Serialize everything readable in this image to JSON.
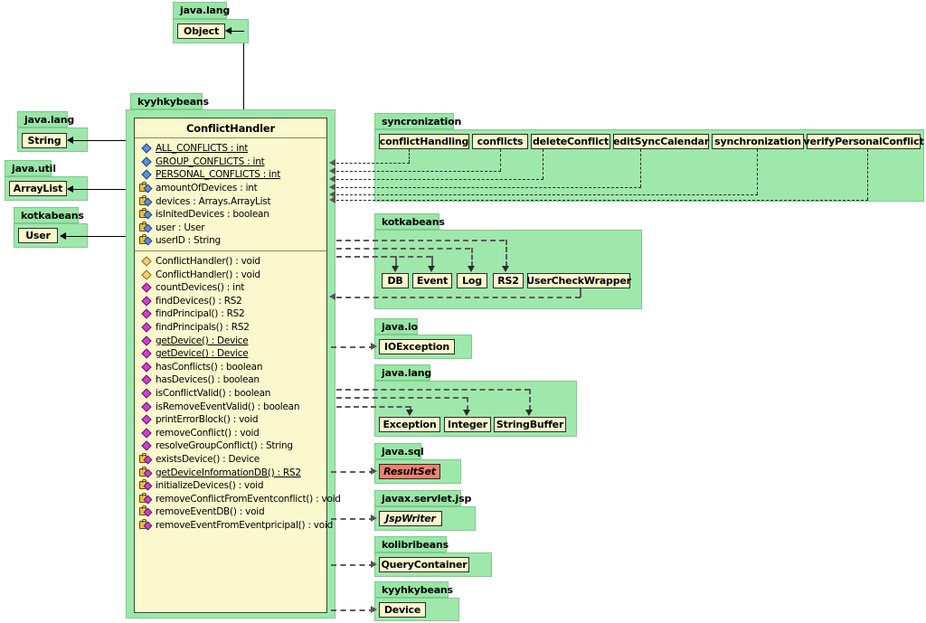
{
  "diagram": {
    "type": "uml-class-diagram",
    "main_class": {
      "package": "kyyhkybeans",
      "name": "ConflictHandler",
      "attributes": [
        {
          "icon": "public-attribute",
          "label": "ALL_CONFLICTS : int",
          "static": true,
          "visibility": "public"
        },
        {
          "icon": "public-attribute",
          "label": "GROUP_CONFLICTS : int",
          "static": true,
          "visibility": "public"
        },
        {
          "icon": "public-attribute",
          "label": "PERSONAL_CONFLICTS : int",
          "static": true,
          "visibility": "public"
        },
        {
          "icon": "private-attribute",
          "label": "amountOfDevices : int",
          "static": false,
          "visibility": "private"
        },
        {
          "icon": "private-attribute",
          "label": "devices : Arrays.ArrayList",
          "static": false,
          "visibility": "private"
        },
        {
          "icon": "private-attribute",
          "label": "isInitedDevices : boolean",
          "static": false,
          "visibility": "private"
        },
        {
          "icon": "private-attribute",
          "label": "user : User",
          "static": false,
          "visibility": "private"
        },
        {
          "icon": "private-attribute",
          "label": "userID : String",
          "static": false,
          "visibility": "private"
        }
      ],
      "methods": [
        {
          "icon": "constructor",
          "label": "ConflictHandler() : void",
          "static": false,
          "visibility": "public"
        },
        {
          "icon": "constructor",
          "label": "ConflictHandler() : void",
          "static": false,
          "visibility": "public"
        },
        {
          "icon": "public-method",
          "label": "countDevices() : int",
          "static": false,
          "visibility": "public"
        },
        {
          "icon": "public-method",
          "label": "findDevices() : RS2",
          "static": false,
          "visibility": "public"
        },
        {
          "icon": "public-method",
          "label": "findPrincipal() : RS2",
          "static": false,
          "visibility": "public"
        },
        {
          "icon": "public-method",
          "label": "findPrincipals() : RS2",
          "static": false,
          "visibility": "public"
        },
        {
          "icon": "public-method",
          "label": "getDevice() : Device",
          "static": true,
          "visibility": "public"
        },
        {
          "icon": "public-method",
          "label": "getDevice() : Device",
          "static": true,
          "visibility": "public"
        },
        {
          "icon": "public-method",
          "label": "hasConflicts() : boolean",
          "static": false,
          "visibility": "public"
        },
        {
          "icon": "public-method",
          "label": "hasDevices() : boolean",
          "static": false,
          "visibility": "public"
        },
        {
          "icon": "public-method",
          "label": "isConflictValid() : boolean",
          "static": false,
          "visibility": "public"
        },
        {
          "icon": "public-method",
          "label": "isRemoveEventValid() : boolean",
          "static": false,
          "visibility": "public"
        },
        {
          "icon": "public-method",
          "label": "printErrorBlock() : void",
          "static": false,
          "visibility": "public"
        },
        {
          "icon": "public-method",
          "label": "removeConflict() : void",
          "static": false,
          "visibility": "public"
        },
        {
          "icon": "public-method",
          "label": "resolveGroupConflict() : String",
          "static": false,
          "visibility": "public"
        },
        {
          "icon": "private-method",
          "label": "existsDevice() : Device",
          "static": false,
          "visibility": "private"
        },
        {
          "icon": "private-method",
          "label": "getDeviceInformationDB() : RS2",
          "static": true,
          "visibility": "private"
        },
        {
          "icon": "private-method",
          "label": "initializeDevices() : void",
          "static": false,
          "visibility": "private"
        },
        {
          "icon": "private-method",
          "label": "removeConflictFromEventconflict() : void",
          "static": false,
          "visibility": "private"
        },
        {
          "icon": "private-method",
          "label": "removeEventDB() : void",
          "static": false,
          "visibility": "private"
        },
        {
          "icon": "private-method",
          "label": "removeEventFromEventpricipal() : void",
          "static": false,
          "visibility": "private"
        }
      ]
    },
    "packages": [
      {
        "id": "pkg-java-lang-object",
        "name": "java.lang",
        "classes": [
          {
            "name": "Object",
            "kind": "class"
          }
        ]
      },
      {
        "id": "pkg-java-lang-string",
        "name": "java.lang",
        "classes": [
          {
            "name": "String",
            "kind": "class"
          }
        ]
      },
      {
        "id": "pkg-java-util",
        "name": "java.util",
        "classes": [
          {
            "name": "ArrayList",
            "kind": "class"
          }
        ]
      },
      {
        "id": "pkg-kotkabeans-user",
        "name": "kotkabeans",
        "classes": [
          {
            "name": "User",
            "kind": "class"
          }
        ]
      },
      {
        "id": "pkg-kyyhkybeans-main",
        "name": "kyyhkybeans",
        "classes": [
          {
            "name": "ConflictHandler",
            "kind": "class"
          }
        ]
      },
      {
        "id": "pkg-syncronization",
        "name": "syncronization",
        "classes": [
          {
            "name": "conflictHandling",
            "kind": "class"
          },
          {
            "name": "conflicts",
            "kind": "class"
          },
          {
            "name": "deleteConflict",
            "kind": "class"
          },
          {
            "name": "editSyncCalendar",
            "kind": "class"
          },
          {
            "name": "synchronization",
            "kind": "class"
          },
          {
            "name": "verifyPersonalConflict",
            "kind": "class"
          }
        ]
      },
      {
        "id": "pkg-kotkabeans",
        "name": "kotkabeans",
        "classes": [
          {
            "name": "DB",
            "kind": "class"
          },
          {
            "name": "Event",
            "kind": "class"
          },
          {
            "name": "Log",
            "kind": "class"
          },
          {
            "name": "RS2",
            "kind": "class"
          },
          {
            "name": "UserCheckWrapper",
            "kind": "class"
          }
        ]
      },
      {
        "id": "pkg-java-io",
        "name": "java.io",
        "classes": [
          {
            "name": "IOException",
            "kind": "class"
          }
        ]
      },
      {
        "id": "pkg-java-lang-2",
        "name": "java.lang",
        "classes": [
          {
            "name": "Exception",
            "kind": "class"
          },
          {
            "name": "Integer",
            "kind": "class"
          },
          {
            "name": "StringBuffer",
            "kind": "class"
          }
        ]
      },
      {
        "id": "pkg-java-sql",
        "name": "java.sql",
        "classes": [
          {
            "name": "ResultSet",
            "kind": "interface"
          }
        ]
      },
      {
        "id": "pkg-javax-servlet-jsp",
        "name": "javax.servlet.jsp",
        "classes": [
          {
            "name": "JspWriter",
            "kind": "interface"
          }
        ]
      },
      {
        "id": "pkg-kolibribeans",
        "name": "kolibribeans",
        "classes": [
          {
            "name": "QueryContainer",
            "kind": "class"
          }
        ]
      },
      {
        "id": "pkg-kyyhkybeans-device",
        "name": "kyyhkybeans",
        "classes": [
          {
            "name": "Device",
            "kind": "class"
          }
        ]
      }
    ],
    "colors": {
      "package_fill": "#9fe8ac",
      "package_tab_fill": "#99e6a6",
      "class_fill": "#fbf8cd",
      "interface_highlight_fill": "#f4806e",
      "line": "#000000",
      "dependency_line": "#555555"
    }
  }
}
